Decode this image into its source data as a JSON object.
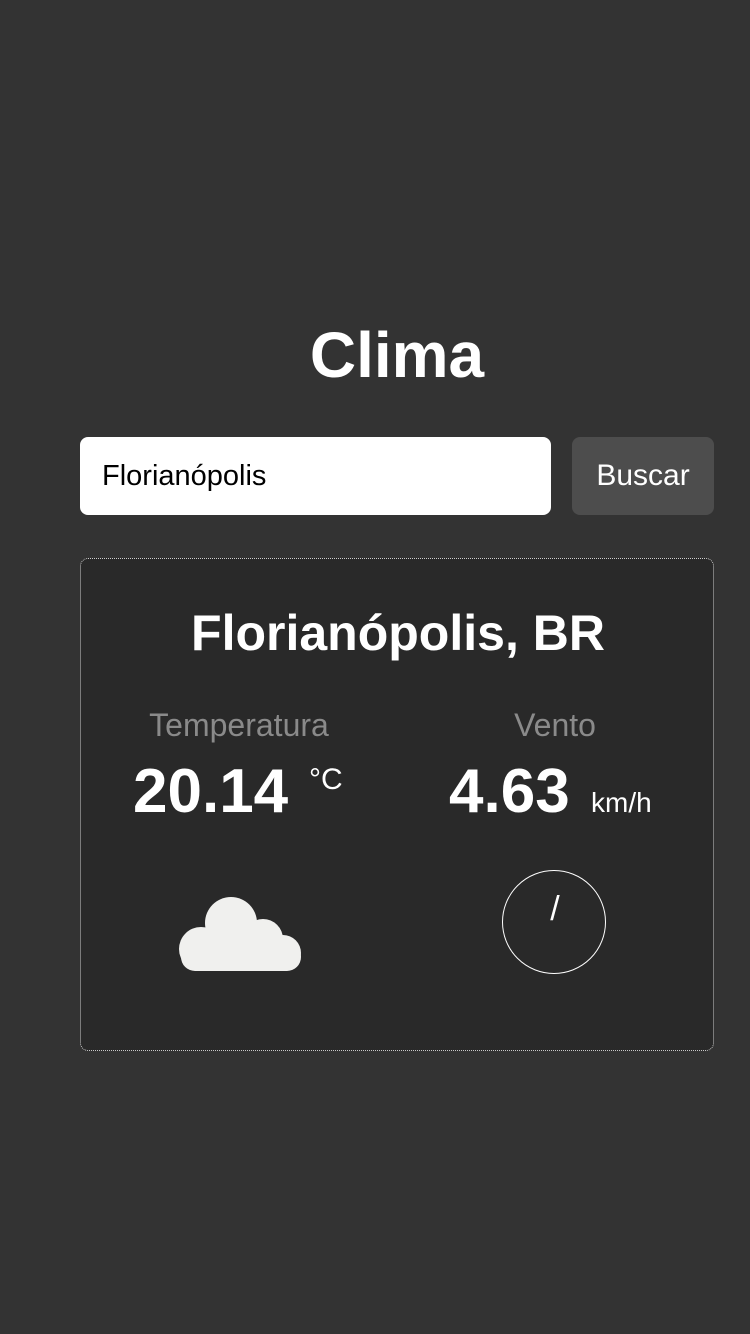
{
  "header": {
    "title": "Clima"
  },
  "search": {
    "value": "Florianópolis",
    "button_label": "Buscar"
  },
  "weather": {
    "location": "Florianópolis, BR",
    "temperature": {
      "label": "Temperatura",
      "value": "20.14",
      "unit": "°C"
    },
    "wind": {
      "label": "Vento",
      "value": "4.63",
      "unit": "km/h",
      "direction_glyph": "/"
    },
    "condition_icon": "cloud-icon",
    "wind_icon": "compass-icon"
  },
  "colors": {
    "background": "#333333",
    "card": "#292929",
    "button": "#4d4d4d",
    "label": "#8a8a8a",
    "cloud": "#f0f0ee"
  }
}
